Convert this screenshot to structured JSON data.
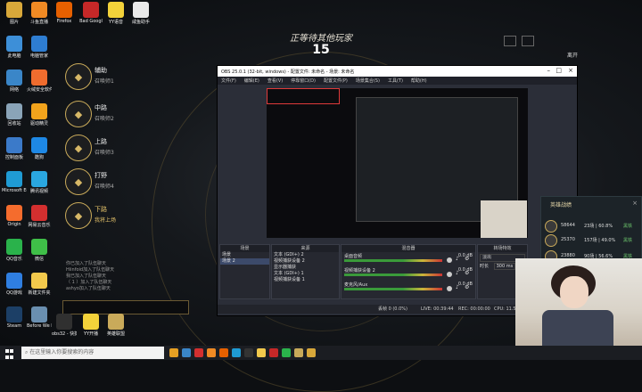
{
  "desktop_icons": [
    {
      "label": "图片",
      "color": "#d8a83a"
    },
    {
      "label": "斗鱼直播",
      "color": "#f08a24"
    },
    {
      "label": "Firefox",
      "color": "#e66000"
    },
    {
      "label": "Bad Googl",
      "color": "#c62828"
    },
    {
      "label": "YY语音",
      "color": "#f3d23a"
    },
    {
      "label": "咸鱼助手",
      "color": "#eaeaea"
    },
    {
      "label": "此电脑",
      "color": "#3d8fd8"
    },
    {
      "label": "电脑管家",
      "color": "#2e7dd1"
    },
    {
      "label": "网络",
      "color": "#3a86c8"
    },
    {
      "label": "火绒安全软件",
      "color": "#ef6c2e"
    },
    {
      "label": "回收站",
      "color": "#8aa4b8"
    },
    {
      "label": "驱动精灵",
      "color": "#f2a31c"
    },
    {
      "label": "控制面板",
      "color": "#3b7ac9"
    },
    {
      "label": "酷狗",
      "color": "#1e88e5"
    },
    {
      "label": "Microsoft Edge",
      "color": "#1f9bd4"
    },
    {
      "label": "腾讯视频",
      "color": "#2aa7e0"
    },
    {
      "label": "Origin",
      "color": "#f56c2d"
    },
    {
      "label": "网易云音乐",
      "color": "#d32f2f"
    },
    {
      "label": "QQ音乐",
      "color": "#2ab24b"
    },
    {
      "label": "微信",
      "color": "#3fbf48"
    },
    {
      "label": "QQ游戏",
      "color": "#2f7ee0"
    },
    {
      "label": "新建文件夹",
      "color": "#f2c94c"
    },
    {
      "label": "Steam",
      "color": "#1c3f66"
    },
    {
      "label": "Before We Leave",
      "color": "#6a8fb0"
    },
    {
      "label": "obs32 - 快捷方式",
      "color": "#303030"
    },
    {
      "label": "YY开播",
      "color": "#f3d23a"
    },
    {
      "label": "英雄联盟",
      "color": "#c9aa5a"
    }
  ],
  "lobby": {
    "title": "正等待其他玩家",
    "countdown": "15",
    "top_right": "离开",
    "slots": [
      {
        "role": "辅助",
        "sub": "召唤师1",
        "glyph": "◆"
      },
      {
        "role": "中路",
        "sub": "召唤师2",
        "glyph": "◆"
      },
      {
        "role": "上路",
        "sub": "召唤师3",
        "glyph": "◆"
      },
      {
        "role": "打野",
        "sub": "召唤师4",
        "glyph": "◆"
      },
      {
        "role": "下路",
        "sub": "我将上场",
        "glyph": "◆"
      }
    ],
    "chat": [
      "你已加入了队伍聊天",
      "Hiinfoid加入了队伍聊天",
      "我已加入了队伍聊天",
      "（ 1 ）加入了队伍聊天",
      "ashyo加入了队伍聊天"
    ]
  },
  "obs": {
    "title": "OBS 25.0.1 (32-bit, windows) - 配置文件: 未命名 - 场景: 未命名",
    "menu": [
      "文件(F)",
      "编辑(E)",
      "查看(V)",
      "停靠窗口(D)",
      "配置文件(P)",
      "场景集合(S)",
      "工具(T)",
      "帮助(H)"
    ],
    "scenes_header": "场景",
    "scenes": [
      "场景",
      "场景 2"
    ],
    "sources_header": "来源",
    "sources": [
      "文本 (GDI+) 2",
      "视频捕获设备 2",
      "显示器捕获",
      "文本 (GDI+) 1",
      "视频捕获设备 1"
    ],
    "mixer_header": "混音器",
    "mixer": [
      {
        "name": "桌面音频",
        "level": "0.0 dB"
      },
      {
        "name": "视频捕获设备 2",
        "level": "0.0 dB"
      },
      {
        "name": "麦克风/Aux",
        "level": "0.0 dB"
      }
    ],
    "transition_header": "转场特效",
    "transition_type": "淡出",
    "duration_label": "时长",
    "duration_value": "300 ms",
    "status": {
      "dropped": "丢帧 0 (0.0%)",
      "live": "LIVE: 00:39:44",
      "rec": "REC: 00:00:00",
      "cpu": "CPU: 11.5%, 30.00 fps"
    }
  },
  "panel": {
    "title": "英雄战绩",
    "rows": [
      {
        "name": "58644",
        "wins": "23场 | 60.8%",
        "rank": "黑铁"
      },
      {
        "name": "25370",
        "wins": "157场 | 49.0%",
        "rank": "黑铁"
      },
      {
        "name": "23880",
        "wins": "90场 | 56.6%",
        "rank": "黑铁"
      }
    ]
  },
  "taskbar": {
    "search_placeholder": "在这里输入你要搜索的内容",
    "apps": [
      "#e6a023",
      "#3a86c8",
      "#d32f2f",
      "#f08a24",
      "#e66000",
      "#1f9bd4",
      "#333",
      "#f2c94c",
      "#c62828",
      "#2ab24b",
      "#c9aa5a",
      "#d8a83a"
    ]
  }
}
